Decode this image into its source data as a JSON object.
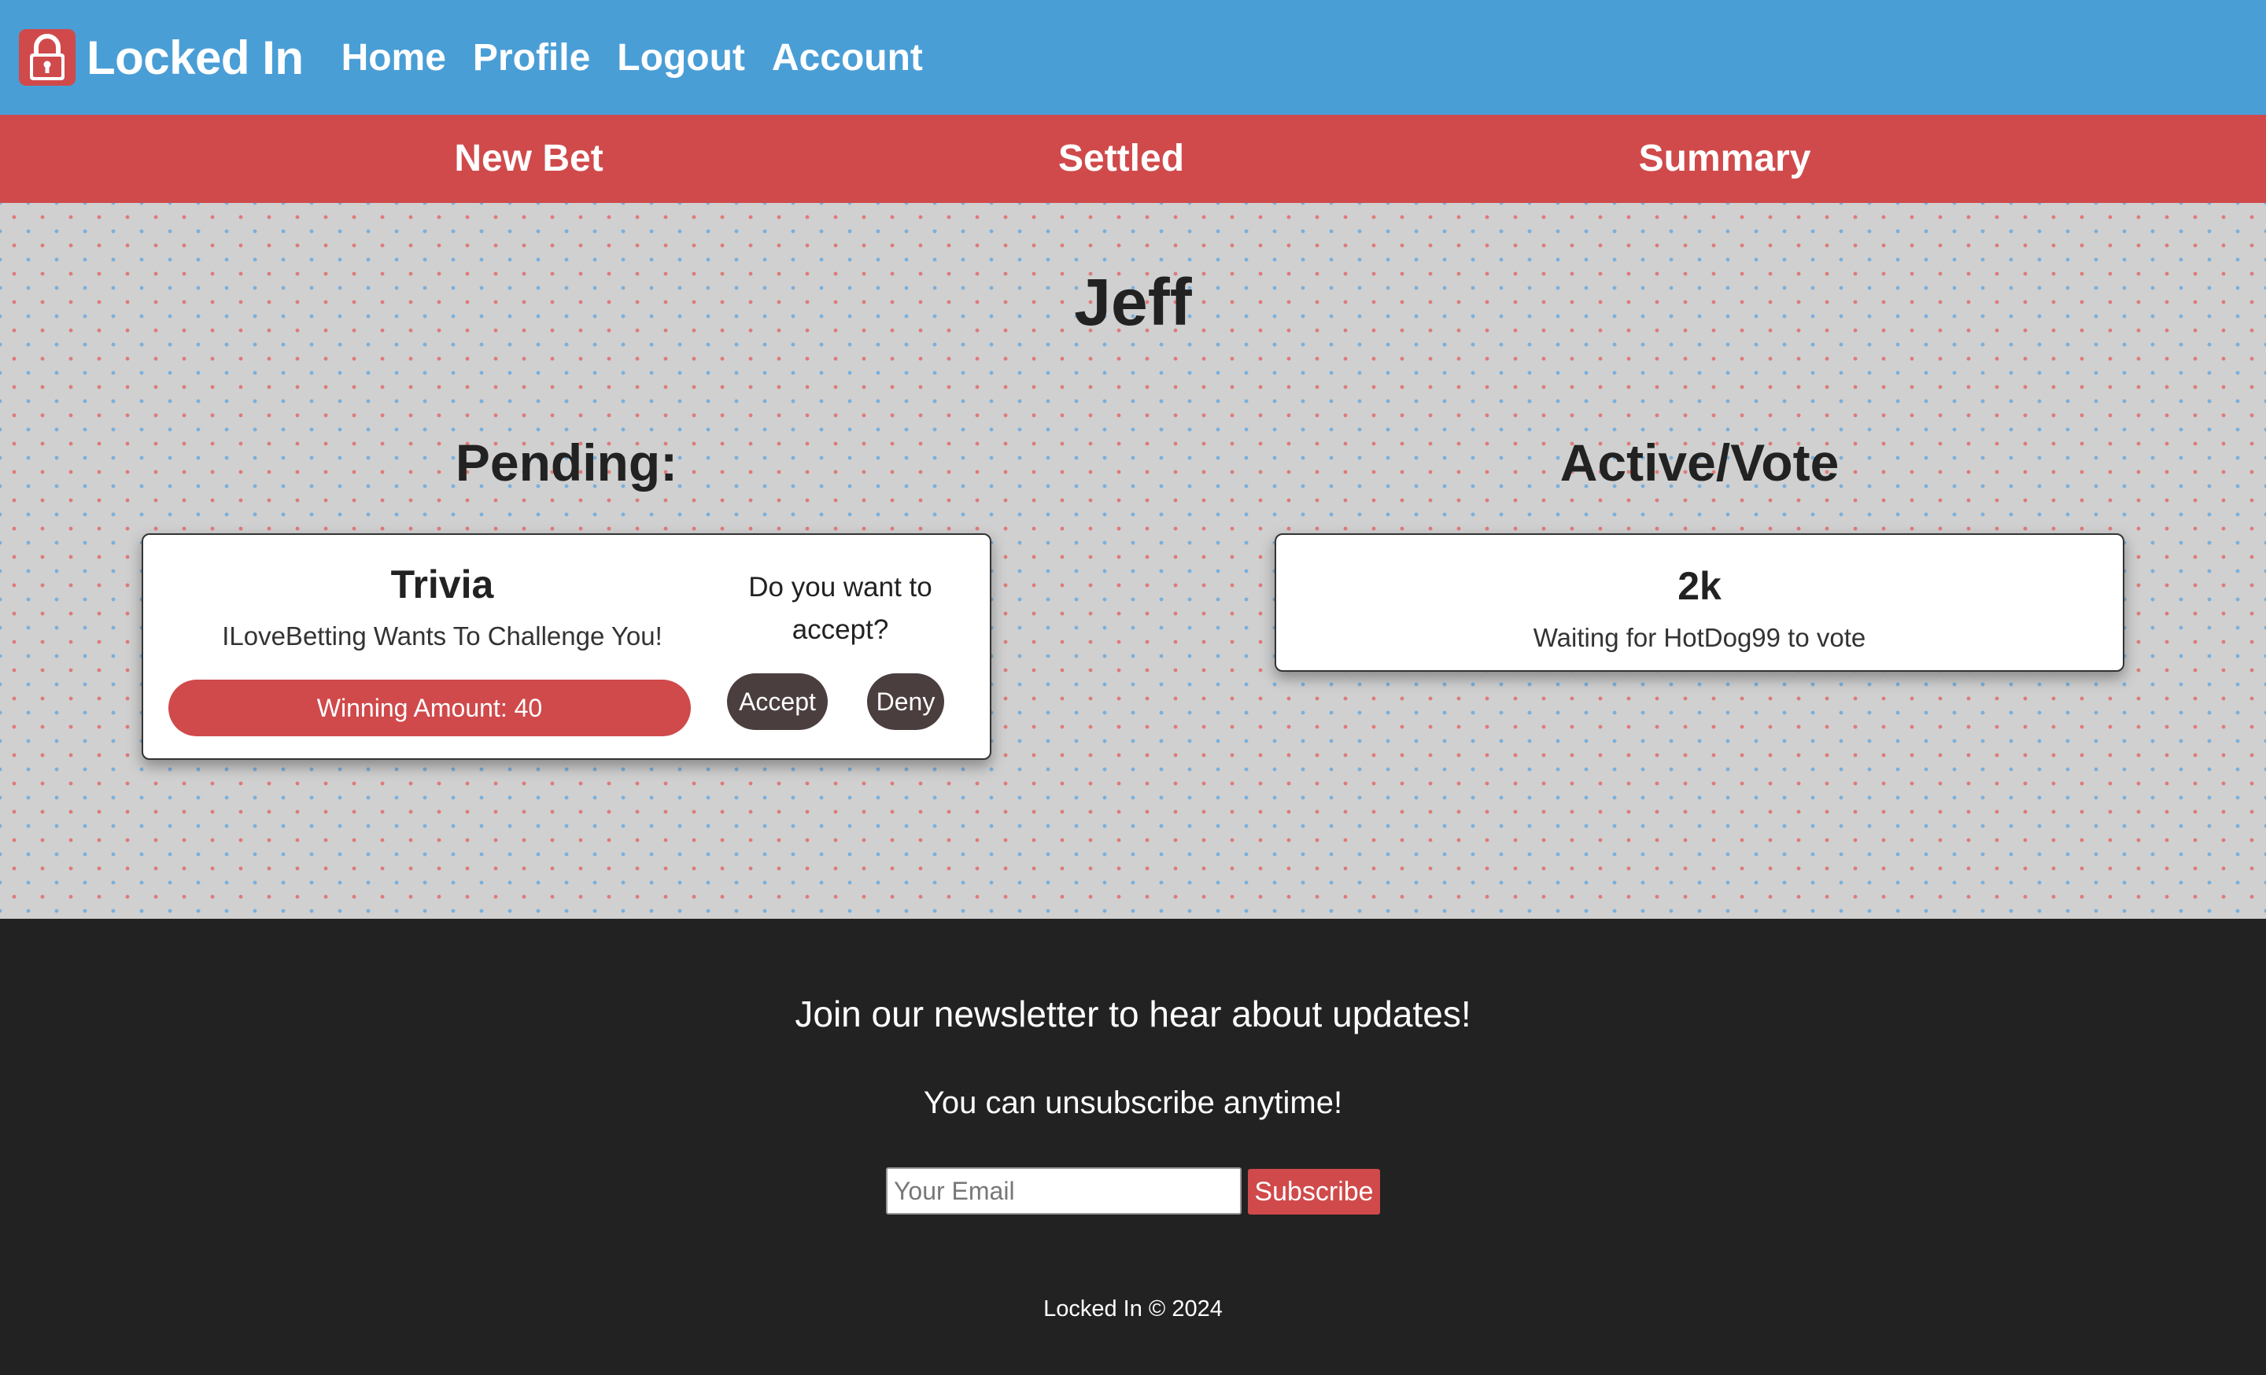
{
  "header": {
    "brand": "Locked In",
    "nav": [
      "Home",
      "Profile",
      "Logout",
      "Account"
    ]
  },
  "subnav": [
    "New Bet",
    "Settled",
    "Summary"
  ],
  "main": {
    "user_name": "Jeff",
    "pending": {
      "heading": "Pending:",
      "cards": [
        {
          "title": "Trivia",
          "challenge": "ILoveBetting Wants To Challenge You!",
          "winning": "Winning Amount: 40",
          "question": "Do you want to accept?",
          "accept_label": "Accept",
          "deny_label": "Deny"
        }
      ]
    },
    "active": {
      "heading": "Active/Vote",
      "cards": [
        {
          "title": "2k",
          "status": "Waiting for HotDog99 to vote"
        }
      ]
    }
  },
  "footer": {
    "newsletter_heading": "Join our newsletter to hear about updates!",
    "newsletter_sub": "You can unsubscribe anytime!",
    "email_placeholder": "Your Email",
    "subscribe_label": "Subscribe",
    "copyright": "Locked In © 2024"
  },
  "colors": {
    "header_bg": "#4a9ed6",
    "subnav_bg": "#d04a4b",
    "footer_bg": "#222222",
    "button_dark": "#4a3e3e",
    "accent_red": "#d04a4b"
  },
  "icons": {
    "brand": "padlock-icon"
  }
}
